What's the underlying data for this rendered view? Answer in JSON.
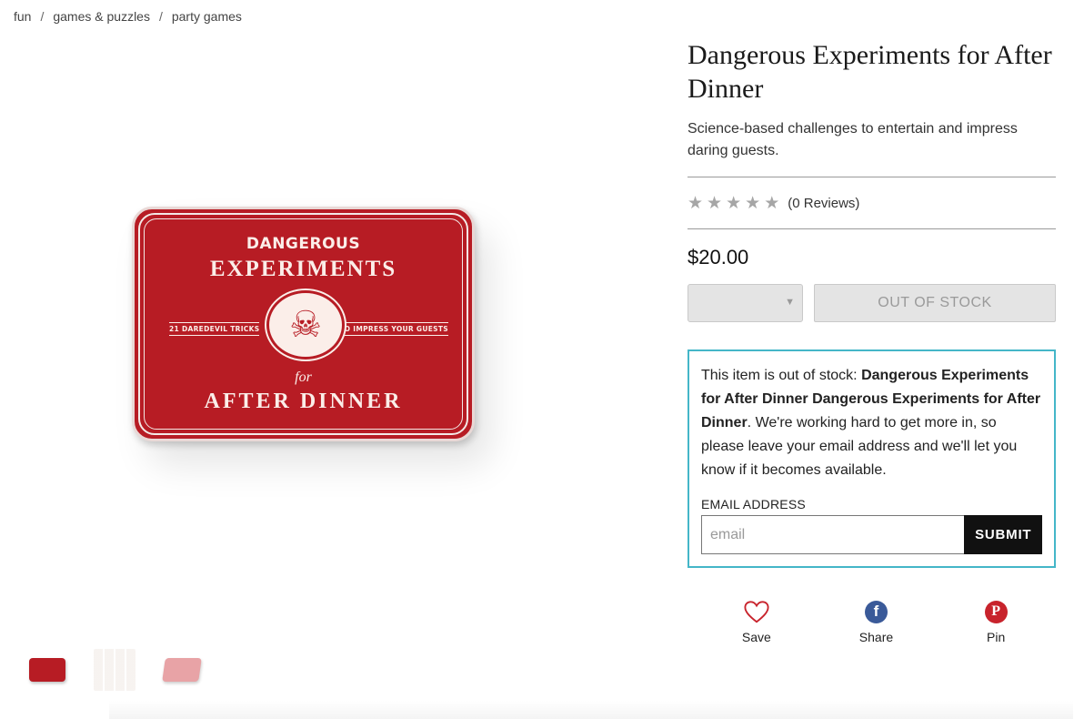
{
  "breadcrumb": [
    "fun",
    "games & puzzles",
    "party games"
  ],
  "product": {
    "title": "Dangerous Experiments for After Dinner",
    "subtitle": "Science-based challenges to entertain and impress daring guests.",
    "reviews": "(0 Reviews)",
    "rating": 0,
    "rating_max": 5,
    "price": "$20.00",
    "stock_button": "OUT OF STOCK"
  },
  "tin_art": {
    "line1": "DANGEROUS",
    "line2": "EXPERIMENTS",
    "left_tag": "21 DAREDEVIL TRICKS",
    "right_tag": "TO IMPRESS YOUR GUESTS",
    "for": "for",
    "line3": "AFTER DINNER"
  },
  "notify": {
    "prefix": "This item is out of stock: ",
    "item_name": "Dangerous Experiments for After Dinner Dangerous Experiments for After Dinner",
    "suffix": ". We're working hard to get more in, so please leave your email address and we'll let you know if it becomes available.",
    "email_label": "EMAIL ADDRESS",
    "email_placeholder": "email",
    "submit_label": "SUBMIT"
  },
  "social": {
    "save": "Save",
    "share": "Share",
    "pin": "Pin"
  },
  "colors": {
    "tin_red": "#b71c24",
    "notify_border": "#44b6c8",
    "save_heart": "#c8232c",
    "facebook": "#3a5a99",
    "pinterest": "#c8232c"
  }
}
